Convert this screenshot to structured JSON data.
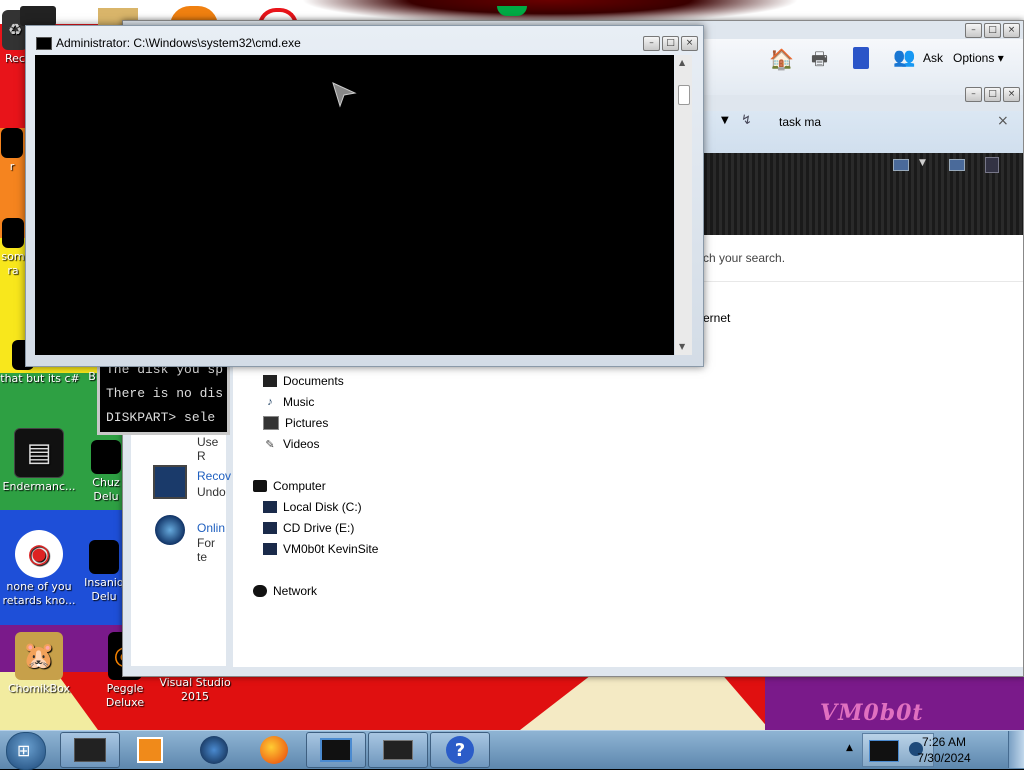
{
  "desktop": {
    "watermark": "VM0b0t",
    "icons": [
      {
        "label": "Rec",
        "glyph": "♻"
      },
      {
        "label": "r",
        "glyph": ""
      },
      {
        "label": "som ra",
        "glyph": ""
      },
      {
        "label": "that but its c#",
        "glyph": ""
      },
      {
        "label": "B",
        "glyph": ""
      },
      {
        "label": "Endermanc...",
        "glyph": "▤"
      },
      {
        "label": "Chuz Delu",
        "glyph": ""
      },
      {
        "label": "none of you retards kno...",
        "glyph": "◉"
      },
      {
        "label": "Insaniq Delu",
        "glyph": ""
      },
      {
        "label": "ChomikBox",
        "glyph": "🐹"
      },
      {
        "label": "Peggle Deluxe",
        "glyph": "◎"
      },
      {
        "label": "Visual Studio 2015",
        "glyph": ""
      }
    ]
  },
  "explorer": {
    "toolbar": {
      "ask_label": "Ask",
      "options_label": "Options ▾"
    },
    "search": {
      "query": "task ma",
      "clear": "×"
    },
    "search_hint": "ch your search.",
    "internet_fragment": "ernet",
    "left_pane": {
      "item1_title": "Use R",
      "item2_title": "Recov",
      "item2_sub": "Undo",
      "item3_title": "Onlin",
      "item3_sub": "For te"
    },
    "nav": {
      "documents": "Documents",
      "music": "Music",
      "pictures": "Pictures",
      "videos": "Videos",
      "computer": "Computer",
      "local_disk": "Local Disk (C:)",
      "cd_drive": "CD Drive (E:)",
      "vm_site": "VM0b0t KevinSite",
      "network": "Network"
    }
  },
  "diskpart": {
    "line1": "The disk you sp",
    "line2": "There is no dis",
    "line3": "DISKPART> sele"
  },
  "cmd": {
    "title": "Administrator: C:\\Windows\\system32\\cmd.exe"
  },
  "taskbar": {
    "time": "7:26 AM",
    "date": "7/30/2024",
    "help_glyph": "?"
  }
}
